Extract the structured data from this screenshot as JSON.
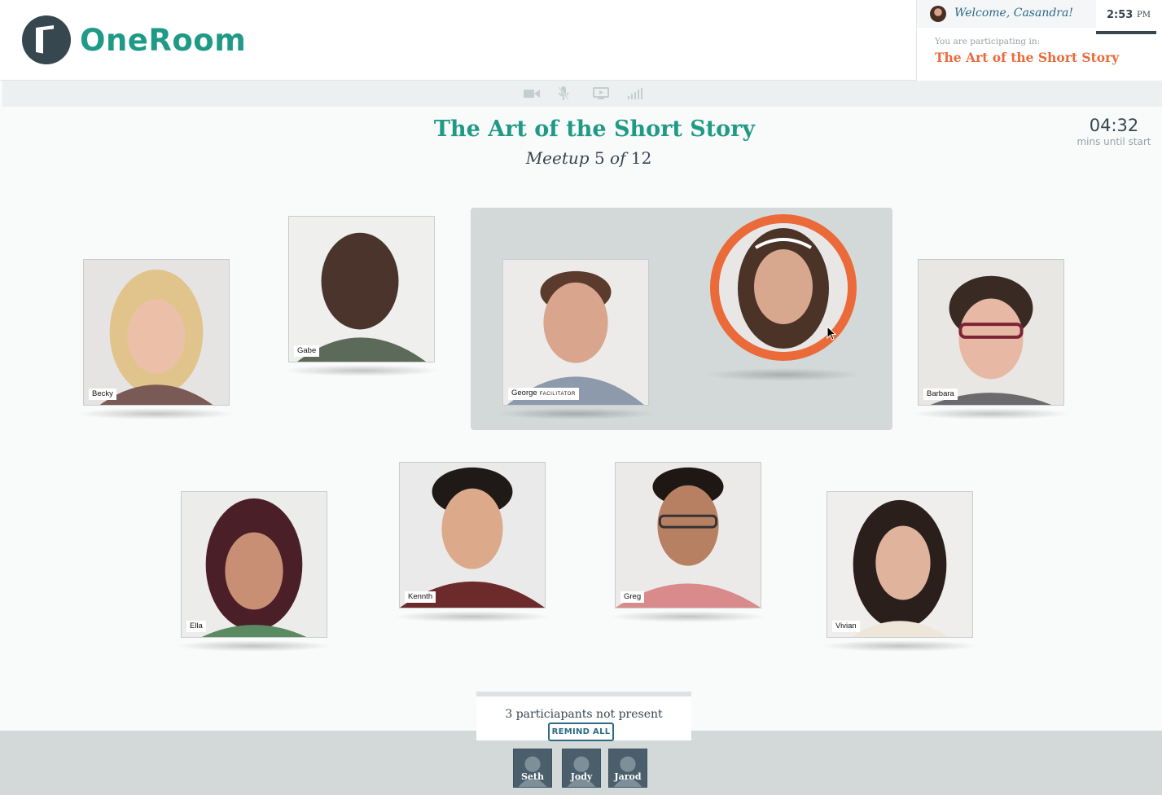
{
  "app": {
    "name": "OneRoom",
    "accent": "#1f9a86",
    "highlight": "#ea6a3a"
  },
  "user": {
    "welcome": "Welcome, Casandra!",
    "time": "2:53",
    "ampm": "PM",
    "participating_label": "You are participating in:",
    "participating_title": "The Art of the Short Story"
  },
  "toolbar": {
    "icons": [
      "video-icon",
      "microphone-icon",
      "screen-share-icon",
      "signal-icon"
    ]
  },
  "meetup": {
    "title": "The Art of the Short Story",
    "sub_word": "Meetup",
    "sub_current": "5",
    "sub_of": "of",
    "sub_total": "12",
    "countdown": "04:32",
    "countdown_label": "mins until start"
  },
  "participants": {
    "becky": "Becky",
    "gabe": "Gabe",
    "george": "George",
    "george_role": "FACILITATOR",
    "barbara": "Barbara",
    "ella": "Ella",
    "kennth": "Kennth",
    "greg": "Greg",
    "vivian": "Vivian"
  },
  "absent": {
    "text": "3 particiapants not present",
    "remind": "REMIND ALL",
    "names": [
      "Seth",
      "Jody",
      "Jarod"
    ]
  }
}
